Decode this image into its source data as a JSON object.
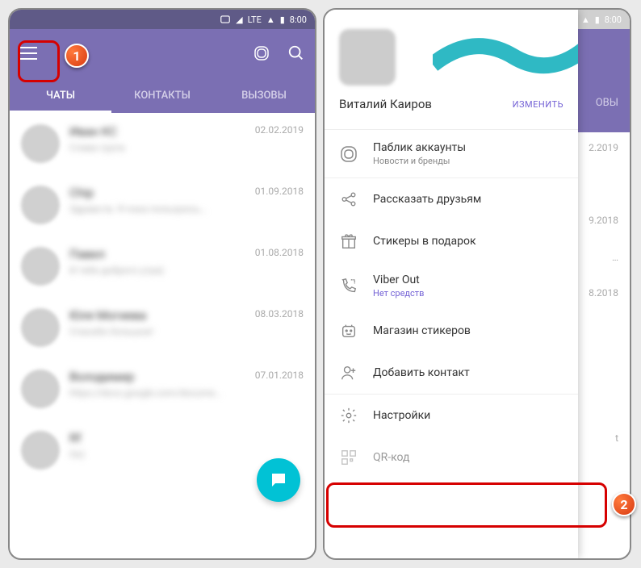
{
  "status": {
    "time": "8:00",
    "lte": "LTE"
  },
  "tabs": {
    "chats": "ЧАТЫ",
    "contacts": "КОНТАКТЫ",
    "calls": "ВЫЗОВЫ"
  },
  "chats": [
    {
      "name": "Иван КС",
      "preview": "Слава група",
      "date": "02.02.2019"
    },
    {
      "name": "Chip",
      "preview": "Здравств. Я пока пользуюсь…",
      "date": "01.09.2018"
    },
    {
      "name": "Павел",
      "preview": "И тебе доброго утра)",
      "date": "01.08.2018"
    },
    {
      "name": "Юля Могиева",
      "preview": "Спасибо большое!",
      "date": "08.03.2018"
    },
    {
      "name": "Володимир",
      "preview": "https://docs.google.com/docume…",
      "date": "07.01.2018"
    },
    {
      "name": "Rf",
      "preview": "Ок)",
      "date": ""
    }
  ],
  "bg_dates": [
    "2.2019",
    "9.2018",
    "",
    "8.2018",
    "",
    ""
  ],
  "bg_tab_calls": "ОВЫ",
  "profile": {
    "name": "Виталий Каиров",
    "change": "ИЗМЕНИТЬ"
  },
  "drawer": {
    "public": {
      "title": "Паблик аккаунты",
      "sub": "Новости и бренды"
    },
    "share": "Рассказать друзьям",
    "stickers_gift": "Стикеры в подарок",
    "viber_out": {
      "title": "Viber Out",
      "sub": "Нет средств"
    },
    "sticker_store": "Магазин стикеров",
    "add_contact": "Добавить контакт",
    "settings": "Настройки",
    "qr": "QR-код"
  },
  "badges": {
    "one": "1",
    "two": "2"
  }
}
